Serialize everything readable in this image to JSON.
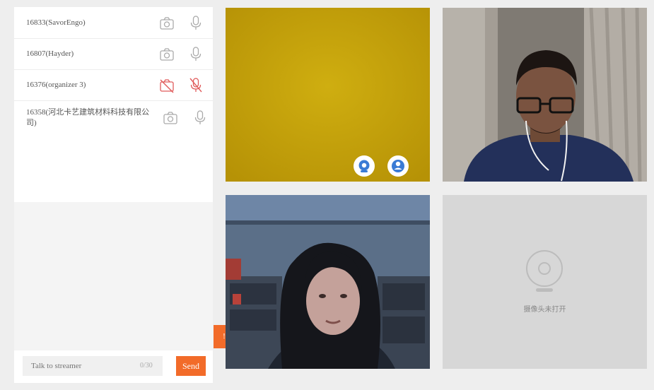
{
  "participants": [
    {
      "name": "16833(SavorEngo)",
      "camera": "on",
      "mic": "on"
    },
    {
      "name": "16807(Hayder)",
      "camera": "on",
      "mic": "on"
    },
    {
      "name": "16376(organizer 3)",
      "camera": "off",
      "mic": "off"
    },
    {
      "name": "16358(河北卡艺建筑材料科技有限公司)",
      "camera": "on",
      "mic": "on"
    }
  ],
  "chat": {
    "placeholder": "Talk to streamer",
    "counter": "0/30",
    "send_label": "Send"
  },
  "collapse_label": "!",
  "camera_off_text": "摄像头未打开",
  "colors": {
    "accent": "#f26b29",
    "control_blue": "#3a7bd5",
    "muted_red": "#e05a5a"
  },
  "icons": {
    "camera": "camera-icon",
    "camera_off": "camera-off-icon",
    "mic": "microphone-icon",
    "mic_off": "microphone-off-icon",
    "webcam_placeholder": "webcam-icon"
  }
}
